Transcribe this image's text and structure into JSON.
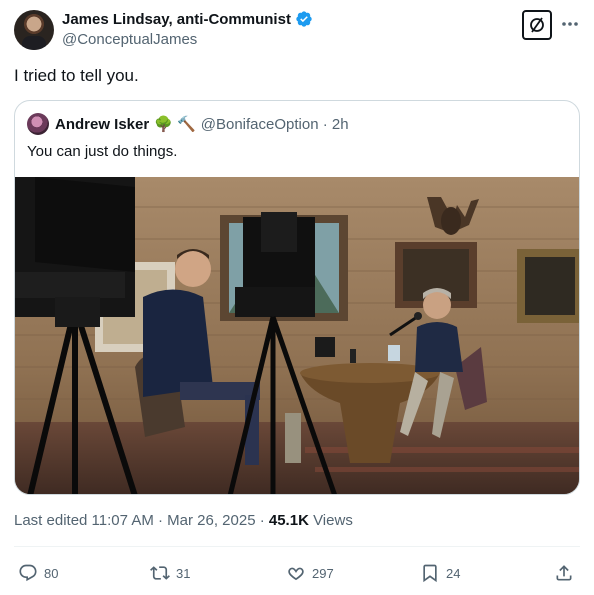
{
  "author": {
    "name": "James Lindsay, anti-Communist",
    "handle": "@ConceptualJames"
  },
  "tweet": {
    "text": "I tried to tell you."
  },
  "quote": {
    "name": "Andrew Isker",
    "emojis": "🌳 🔨",
    "handle_time": "@BonifaceOption · 2h",
    "text": "You can just do things."
  },
  "meta": {
    "edited": "Last edited 11:07 AM · Mar 26, 2025 · ",
    "views_count": "45.1K",
    "views_label": " Views"
  },
  "actions": {
    "replies": "80",
    "reposts": "31",
    "likes": "297",
    "bookmarks": "24"
  },
  "colors": {
    "accent": "#1d9bf0",
    "text": "#0f1419",
    "muted": "#536471",
    "border": "#cfd9de"
  }
}
